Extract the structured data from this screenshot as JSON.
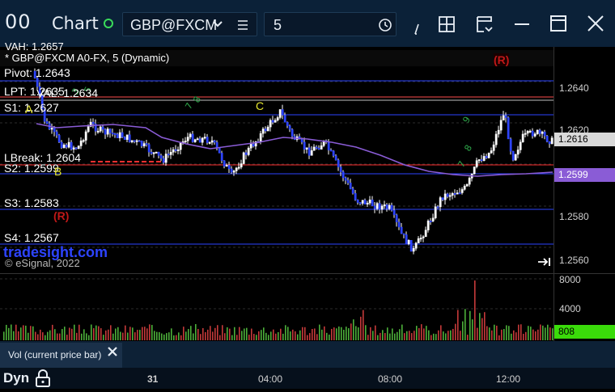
{
  "titlebar": {
    "logo": "00",
    "title": "Chart",
    "status_dot_color": "#3adb5a",
    "symbol": "GBP@FXCM",
    "interval": "5",
    "icons": [
      "chevron-down-icon",
      "list-icon",
      "clock-icon",
      "draw-icon",
      "layout-icon",
      "template-icon",
      "minimize-icon",
      "maximize-icon",
      "close-icon"
    ]
  },
  "chart": {
    "header_label": "* GBP@FXCM A0-FX, 5 (Dynamic)",
    "top_partial_label": "VAH: 1.2657",
    "r_markers": [
      "(R)",
      "(R)"
    ],
    "levels": [
      {
        "label": "Pivot: 1.2643",
        "color": "#2d44ff"
      },
      {
        "label": "LPT: 1.2635",
        "color": "#ff4d4d"
      },
      {
        "label": "VAL: 1.2634",
        "color": "#c0c0c0"
      },
      {
        "label": "S1: 1.2627",
        "color": "#2d44ff"
      },
      {
        "label": "LBreak: 1.2604",
        "color": "#ff2a2a"
      },
      {
        "label": "S2: 1.2599",
        "color": "#2d44ff"
      },
      {
        "label": "S3: 1.2583",
        "color": "#2d44ff"
      },
      {
        "label": "S4: 1.2567",
        "color": "#2d44ff"
      }
    ],
    "letters": [
      "A",
      "B",
      "C"
    ],
    "watermark": "tradesight.com",
    "copyright": "© eSignal, 2022",
    "price_ticks": [
      "1.2640",
      "1.2620",
      "1.2580",
      "1.2560"
    ],
    "current_price": "1.2616",
    "ma_price": "1.2599",
    "ma_color": "#8a5cd6"
  },
  "volume": {
    "ticks": [
      "8000",
      "4000"
    ],
    "current": "808",
    "current_color": "#3adb0a",
    "study_label": "Vol (current price bar)"
  },
  "timebar": {
    "dyn": "Dyn",
    "labels": [
      "31",
      "04:00",
      "08:00",
      "12:00"
    ]
  }
}
